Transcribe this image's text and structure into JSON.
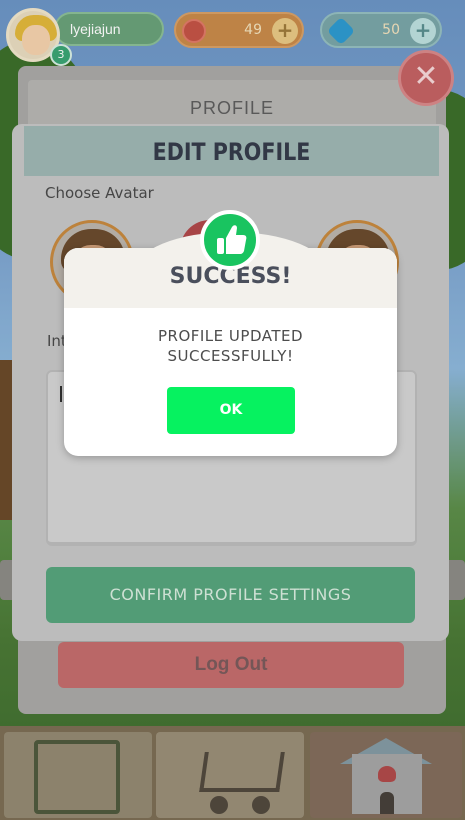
{
  "user": {
    "name": "lyejiajun",
    "level": "3"
  },
  "resources": {
    "coins": "49",
    "gems": "50",
    "plus": "+"
  },
  "close_glyph": "✕",
  "profile_panel": {
    "title": "PROFILE",
    "logout_label": "Log Out"
  },
  "edit_profile": {
    "title": "EDIT PROFILE",
    "choose_avatar_label": "Choose Avatar",
    "info_label": "Int",
    "confirm_label": "CONFIRM PROFILE SETTINGS"
  },
  "dialog": {
    "title": "SUCCESS!",
    "message_line1": "PROFILE UPDATED",
    "message_line2": "SUCCESSFULLY!",
    "ok_label": "OK",
    "badge_icon": "thumbs-up-icon"
  },
  "bottom_nav": [
    {
      "name": "map",
      "icon": "map-icon"
    },
    {
      "name": "shop",
      "icon": "shopping-cart-icon"
    },
    {
      "name": "home",
      "icon": "home-heart-icon"
    }
  ],
  "colors": {
    "success_green": "#06f260",
    "badge_green": "#19c460",
    "confirm_green": "#57a57d",
    "header_teal": "#9fb7b4",
    "close_red": "#c46264"
  }
}
